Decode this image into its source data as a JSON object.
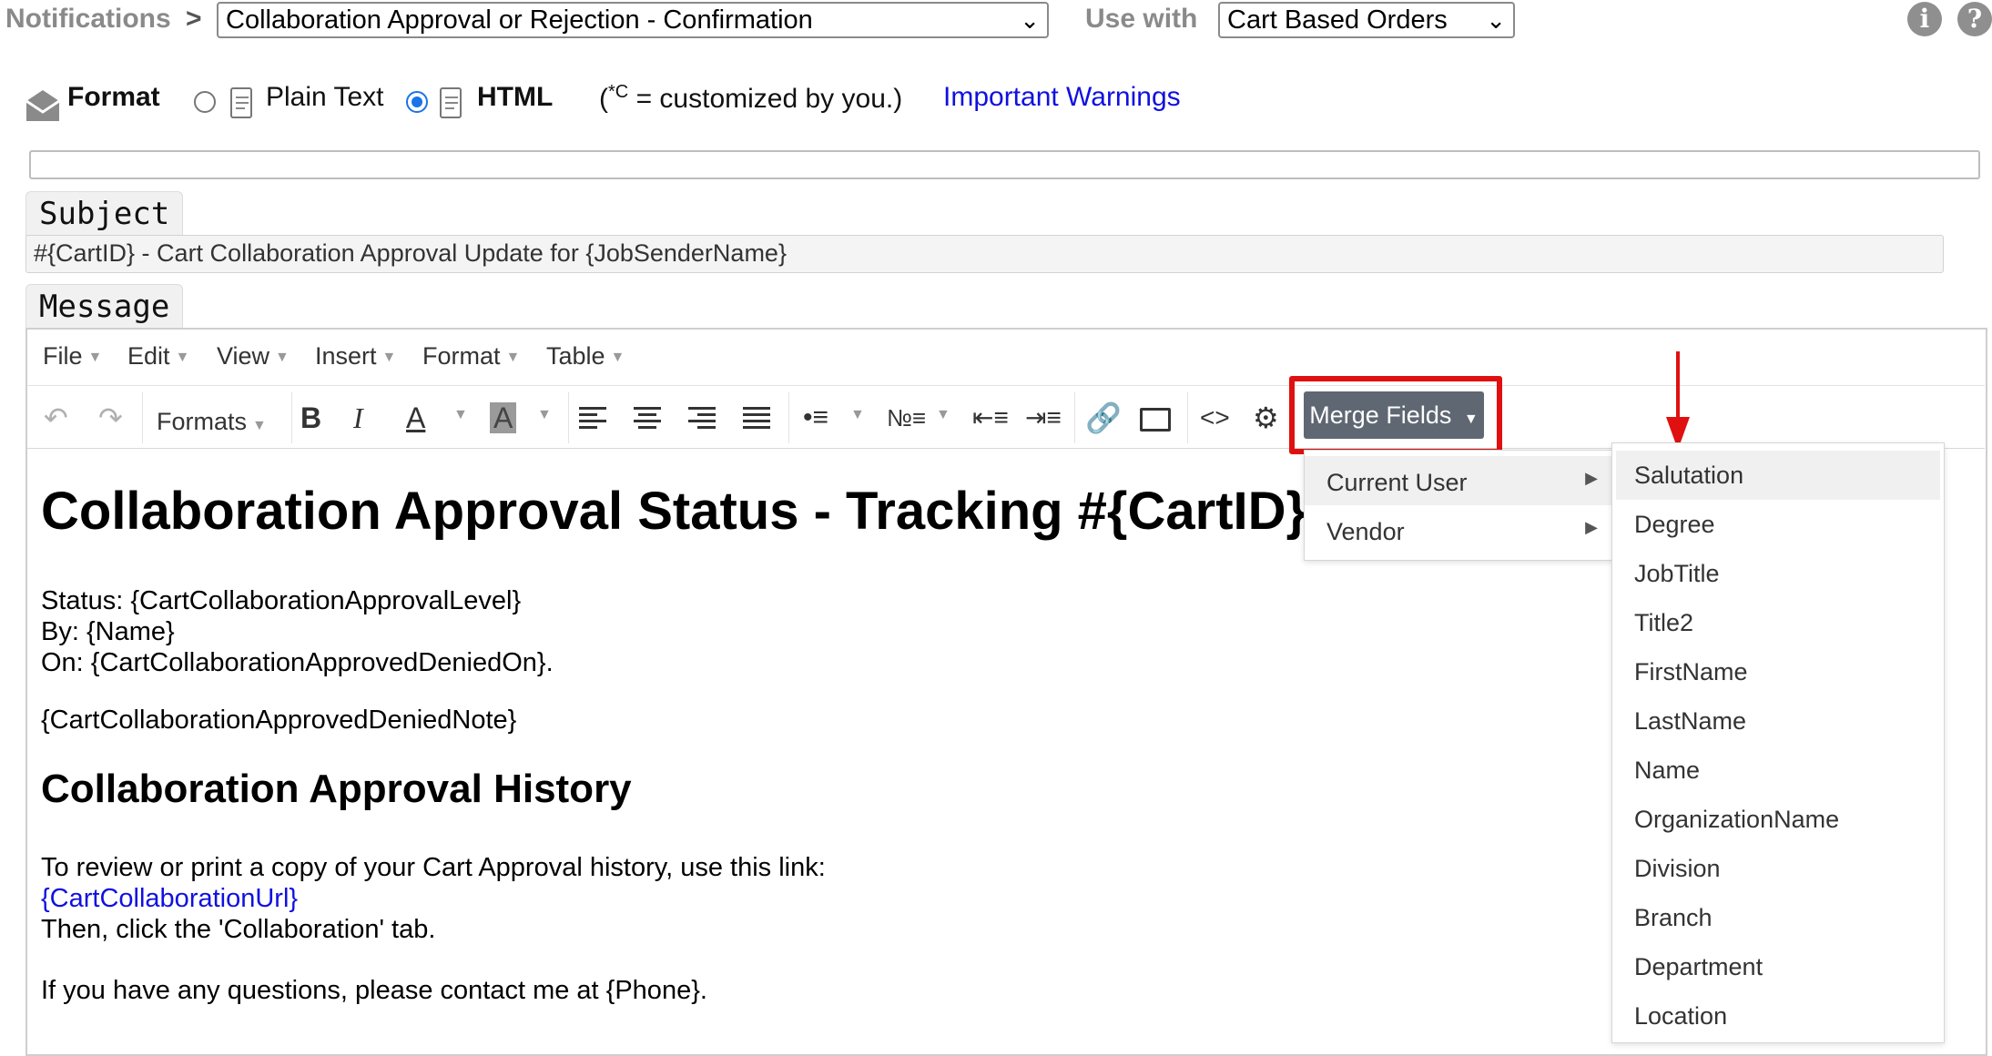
{
  "header": {
    "breadcrumb": "Notifications",
    "separator": ">",
    "notification_select": "Collaboration Approval or Rejection - Confirmation",
    "use_with_label": "Use with",
    "use_with_select": "Cart Based Orders",
    "info_icon": "info-icon",
    "help_icon": "help-icon"
  },
  "format": {
    "label": "Format",
    "plain_text": "Plain Text",
    "html": "HTML",
    "selected": "HTML",
    "legend_open": "(",
    "legend_super": "*C",
    "legend_rest": " = customized by you.)",
    "warnings_link": "Important Warnings"
  },
  "subject": {
    "tab": "Subject",
    "value": "#{CartID} - Cart Collaboration Approval Update for {JobSenderName}"
  },
  "message": {
    "tab": "Message",
    "menubar": [
      "File",
      "Edit",
      "View",
      "Insert",
      "Format",
      "Table"
    ],
    "toolbar": {
      "formats": "Formats",
      "merge_fields": "Merge Fields"
    },
    "content": {
      "heading": "Collaboration Approval Status - Tracking #{CartID}",
      "lines1": [
        "Status: {CartCollaborationApprovalLevel}",
        "By: {Name}",
        "On: {CartCollaborationApprovedDeniedOn}."
      ],
      "note": "{CartCollaborationApprovedDeniedNote}",
      "heading2": "Collaboration Approval History",
      "review": "To review or print a copy of your Cart Approval history, use this link:",
      "url": "{CartCollaborationUrl}",
      "then": "Then, click the 'Collaboration' tab.",
      "contact": "If you have any questions, please contact me at {Phone}."
    }
  },
  "merge_menu": {
    "groups": [
      "Current User",
      "Vendor"
    ],
    "active_group": "Current User",
    "fields": [
      "Salutation",
      "Degree",
      "JobTitle",
      "Title2",
      "FirstName",
      "LastName",
      "Name",
      "OrganizationName",
      "Division",
      "Branch",
      "Department",
      "Location"
    ],
    "active_field": "Salutation"
  },
  "colors": {
    "highlight": "#e01010",
    "merge_button": "#5f6772",
    "link": "#1010e0",
    "radio": "#1a73e8"
  }
}
